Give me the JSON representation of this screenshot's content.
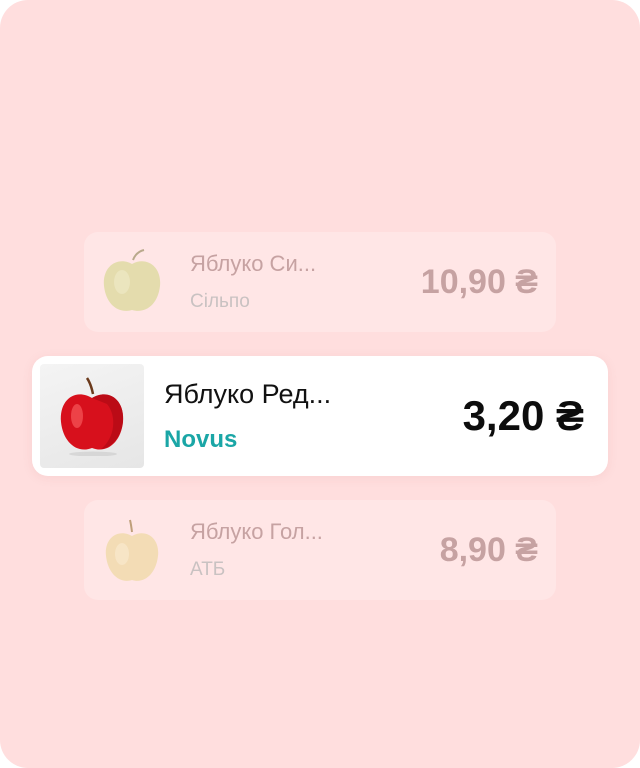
{
  "offers": [
    {
      "name": "Яблуко Си...",
      "store": "Сільпо",
      "price": "10,90 ₴",
      "image_icon": "yellow-apple-icon",
      "state": "faded"
    },
    {
      "name": "Яблуко Ред...",
      "store": "Novus",
      "price": "3,20 ₴",
      "image_icon": "red-apple-icon",
      "state": "active"
    },
    {
      "name": "Яблуко Гол...",
      "store": "АТБ",
      "price": "8,90 ₴",
      "image_icon": "golden-apple-icon",
      "state": "faded"
    }
  ],
  "colors": {
    "background": "#ffdede",
    "store_accent": "#1aa6a6",
    "faded_text": "#c6a2a2"
  }
}
